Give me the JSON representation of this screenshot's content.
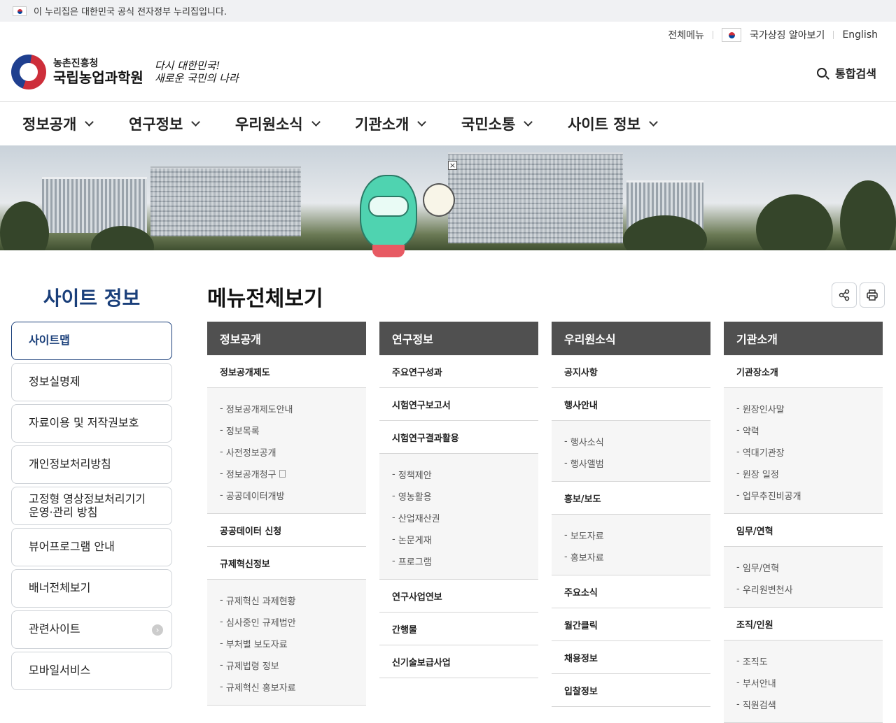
{
  "gov_banner": {
    "text": "이 누리집은 대한민국 공식 전자정부 누리집입니다."
  },
  "utility": {
    "all_menu": "전체메뉴",
    "national_symbol": "국가상징 알아보기",
    "english": "English"
  },
  "logo": {
    "sub": "농촌진흥청",
    "main": "국립농업과학원",
    "slogan_line1": "다시 대한민국!",
    "slogan_line2": "새로운 국민의 나라"
  },
  "search": {
    "label": "통합검색"
  },
  "gnb": [
    "정보공개",
    "연구정보",
    "우리원소식",
    "기관소개",
    "국민소통",
    "사이트 정보"
  ],
  "sidebar": {
    "title": "사이트 정보",
    "items": [
      "사이트맵",
      "정보실명제",
      "자료이용 및 저작권보호",
      "개인정보처리방침",
      "고정형 영상정보처리기기\n운영·관리 방침",
      "뷰어프로그램 안내",
      "배너전체보기",
      "관련사이트",
      "모바일서비스"
    ]
  },
  "page": {
    "title": "메뉴전체보기"
  },
  "sitemap": [
    {
      "head": "정보공개",
      "groups": [
        {
          "title": "정보공개제도",
          "subs": [
            "정보공개제도안내",
            "정보목록",
            "사전정보공개",
            "정보공개청구",
            "공공데이터개방"
          ]
        },
        {
          "title": "공공데이터 신청",
          "subs": []
        },
        {
          "title": "규제혁신정보",
          "subs": [
            "규제혁신 과제현황",
            "심사중인 규제법안",
            "부처별 보도자료",
            "규제법령 정보",
            "규제혁신 홍보자료"
          ]
        }
      ]
    },
    {
      "head": "연구정보",
      "groups": [
        {
          "title": "주요연구성과",
          "subs": []
        },
        {
          "title": "시험연구보고서",
          "subs": []
        },
        {
          "title": "시험연구결과활용",
          "subs": [
            "정책제안",
            "영농활용",
            "산업재산권",
            "논문게재",
            "프로그램"
          ]
        },
        {
          "title": "연구사업연보",
          "subs": []
        },
        {
          "title": "간행물",
          "subs": []
        },
        {
          "title": "신기술보급사업",
          "subs": []
        }
      ]
    },
    {
      "head": "우리원소식",
      "groups": [
        {
          "title": "공지사항",
          "subs": []
        },
        {
          "title": "행사안내",
          "subs": [
            "행사소식",
            "행사앨범"
          ]
        },
        {
          "title": "홍보/보도",
          "subs": [
            "보도자료",
            "홍보자료"
          ]
        },
        {
          "title": "주요소식",
          "subs": []
        },
        {
          "title": "월간클릭",
          "subs": []
        },
        {
          "title": "채용정보",
          "subs": []
        },
        {
          "title": "입찰정보",
          "subs": []
        }
      ]
    },
    {
      "head": "기관소개",
      "groups": [
        {
          "title": "기관장소개",
          "subs": [
            "원장인사말",
            "약력",
            "역대기관장",
            "원장 일정",
            "업무추진비공개"
          ]
        },
        {
          "title": "임무/연혁",
          "subs": [
            "임무/연혁",
            "우리원변천사"
          ]
        },
        {
          "title": "조직/인원",
          "subs": [
            "조직도",
            "부서안내",
            "직원검색"
          ]
        }
      ]
    }
  ]
}
